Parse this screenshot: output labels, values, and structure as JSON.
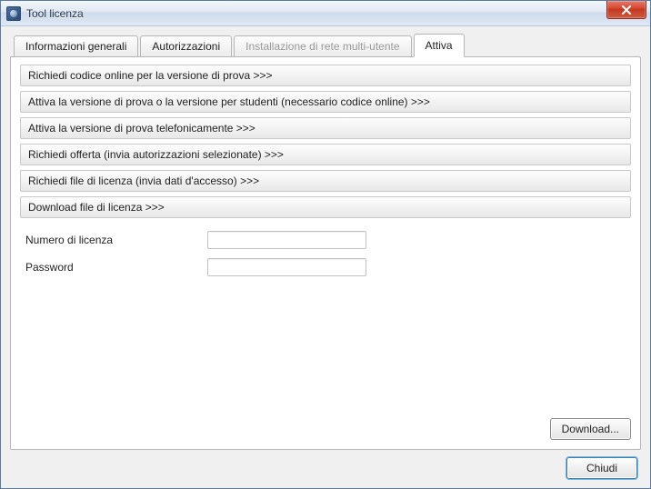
{
  "window": {
    "title": "Tool licenza"
  },
  "tabs": {
    "t0": "Informazioni generali",
    "t1": "Autorizzazioni",
    "t2": "Installazione di rete multi-utente",
    "t3": "Attiva"
  },
  "accordion": {
    "r0": "Richiedi codice online per la versione di prova >>>",
    "r1": "Attiva la versione di prova o la versione per studenti (necessario codice online) >>>",
    "r2": "Attiva la versione di prova telefonicamente >>>",
    "r3": "Richiedi offerta (invia autorizzazioni selezionate) >>>",
    "r4": "Richiedi file di licenza (invia dati d'accesso) >>>",
    "r5": "Download file di licenza >>>"
  },
  "form": {
    "license_label": "Numero di licenza",
    "license_value": "",
    "password_label": "Password",
    "password_value": ""
  },
  "buttons": {
    "download": "Download...",
    "close": "Chiudi"
  }
}
